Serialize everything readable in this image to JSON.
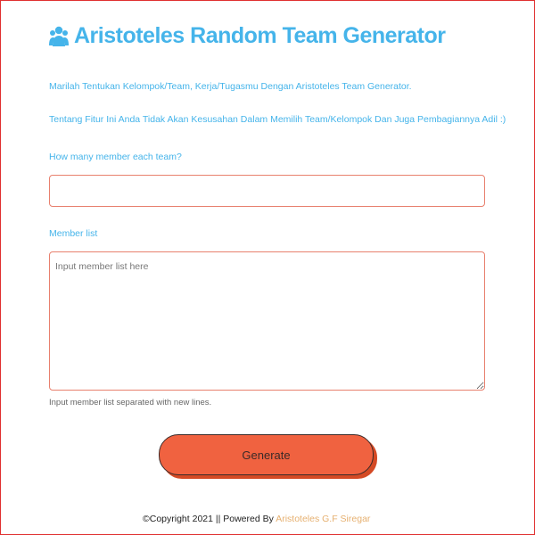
{
  "header": {
    "icon": "users-icon",
    "title": "Aristoteles Random Team Generator"
  },
  "intro": {
    "line1": "Marilah Tentukan Kelompok/Team, Kerja/Tugasmu Dengan Aristoteles Team Generator.",
    "line2": "Tentang Fitur Ini Anda Tidak Akan Kesusahan Dalam Memilih Team/Kelompok Dan Juga Pembagiannya Adil :)"
  },
  "form": {
    "count_label": "How many member each team?",
    "count_value": "",
    "members_label": "Member list",
    "members_placeholder": "Input member list here",
    "members_value": "",
    "members_help": "Input member list separated with new lines.",
    "generate_label": "Generate"
  },
  "footer": {
    "copyright_symbol": "©",
    "text": "Copyright 2021 || Powered By ",
    "author": "Aristoteles G.F Siregar"
  },
  "colors": {
    "accent": "#45b4ea",
    "button": "#f06240",
    "button_shadow": "#d44a25",
    "input_border": "#e8806e",
    "footer_link": "#e6b070"
  }
}
